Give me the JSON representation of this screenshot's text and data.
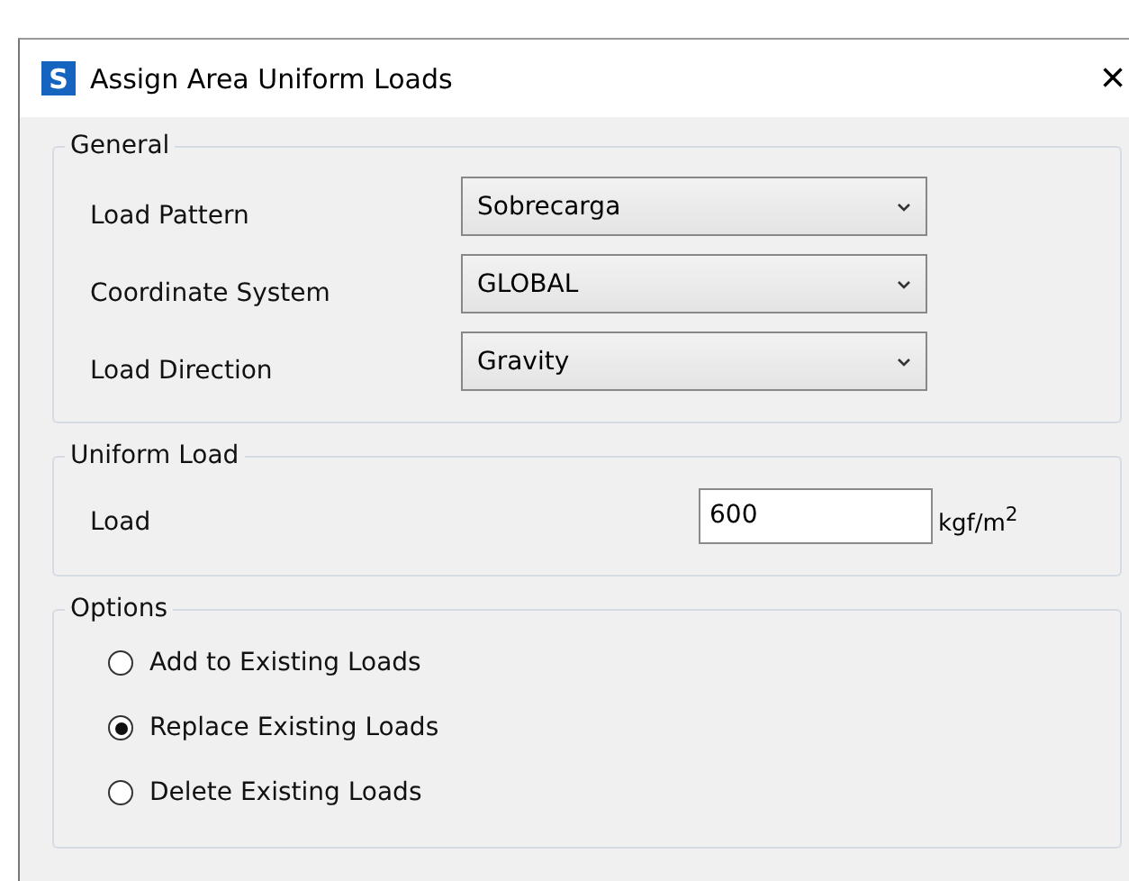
{
  "window": {
    "title": "Assign Area Uniform Loads",
    "app_icon": "S",
    "close": "×"
  },
  "general": {
    "title": "General",
    "fields": [
      {
        "label": "Load Pattern",
        "value": "Sobrecarga"
      },
      {
        "label": "Coordinate System",
        "value": "GLOBAL"
      },
      {
        "label": "Load Direction",
        "value": "Gravity"
      }
    ]
  },
  "uniform_load": {
    "title": "Uniform Load",
    "label": "Load",
    "value": "600",
    "unit": "kgf/m$^{2}$"
  },
  "options": {
    "title": "Options",
    "items": [
      {
        "label": "Add to Existing Loads",
        "selected": false
      },
      {
        "label": "Replace Existing Loads",
        "selected": true
      },
      {
        "label": "Delete Existing Loads",
        "selected": false
      }
    ]
  }
}
